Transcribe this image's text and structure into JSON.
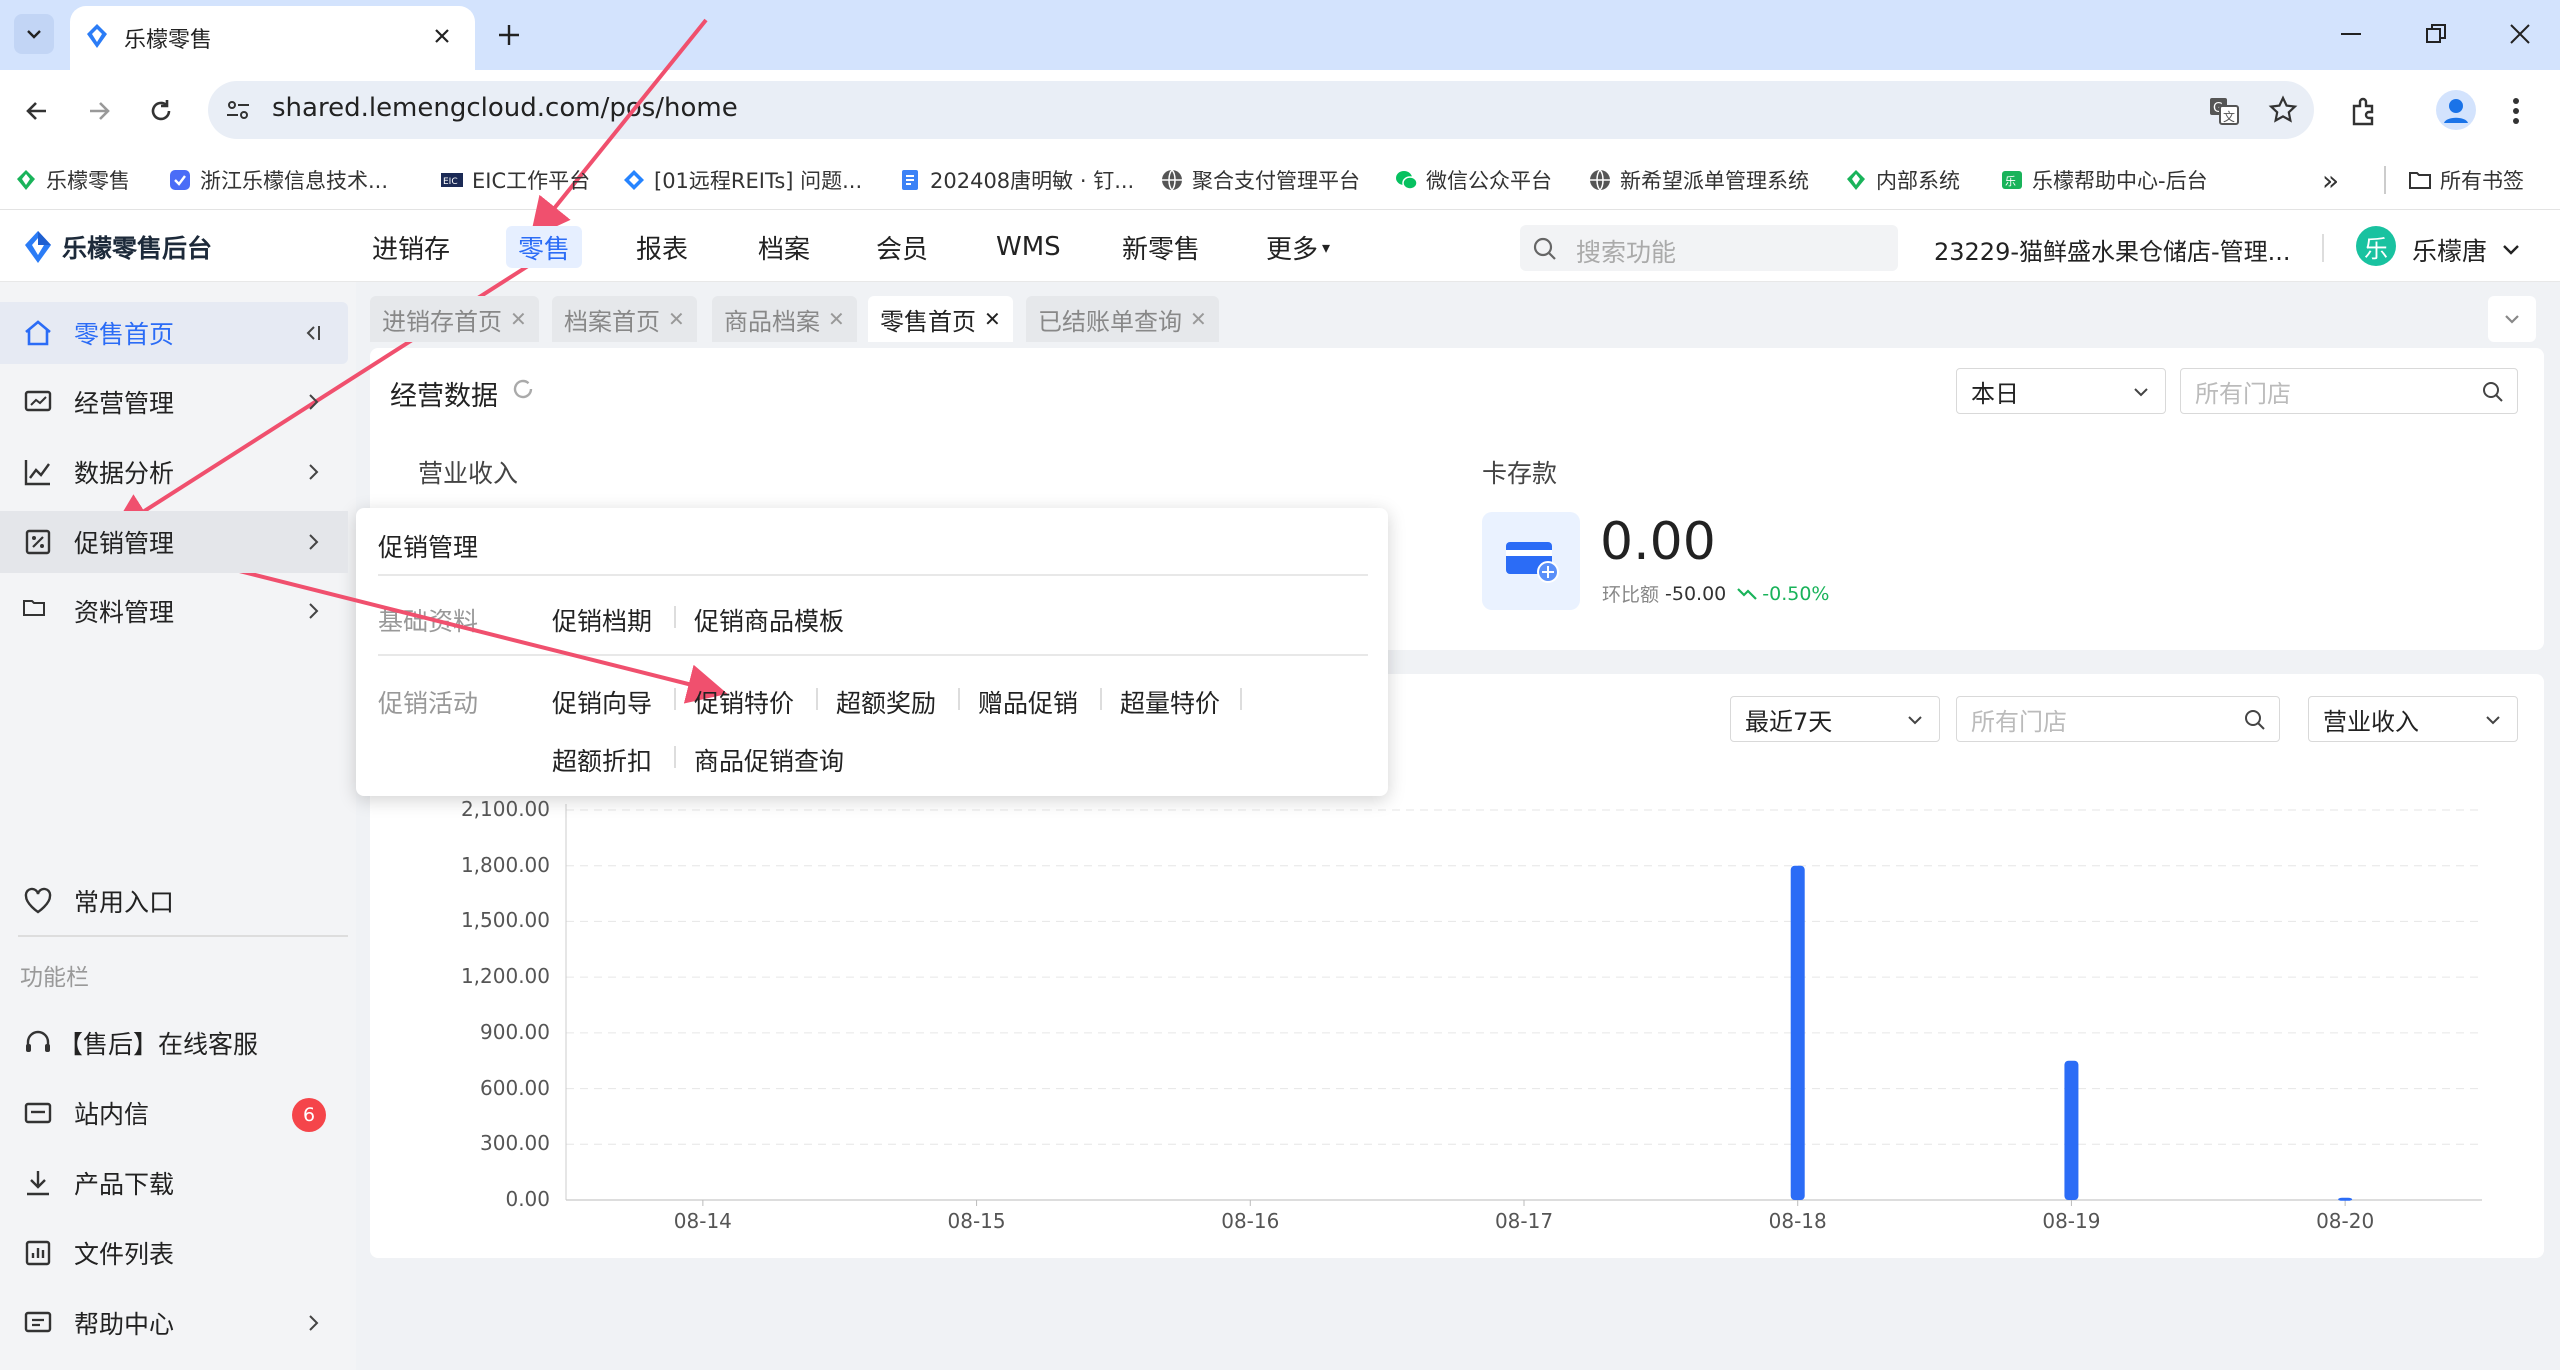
{
  "browser": {
    "tab_title": "乐檬零售",
    "url": "shared.lemengcloud.com/pos/home",
    "bookmarks": [
      {
        "label": "乐檬零售",
        "icon": "lemon-leaf-icon"
      },
      {
        "label": "浙江乐檬信息技术...",
        "icon": "app-icon"
      },
      {
        "label": "EIC工作平台",
        "icon": "eic-icon"
      },
      {
        "label": "[01远程REITs] 问题...",
        "icon": "jira-icon"
      },
      {
        "label": "202408唐明敏 · 钉...",
        "icon": "doc-icon"
      },
      {
        "label": "聚合支付管理平台",
        "icon": "globe-icon"
      },
      {
        "label": "微信公众平台",
        "icon": "wechat-icon"
      },
      {
        "label": "新希望派单管理系统",
        "icon": "globe-icon"
      },
      {
        "label": "内部系统",
        "icon": "lemon-leaf-icon"
      },
      {
        "label": "乐檬帮助中心-后台",
        "icon": "help-logo-icon"
      }
    ],
    "bookmarks_more": "»",
    "all_bookmarks": "所有书签"
  },
  "app": {
    "logo_text": "乐檬零售后台",
    "nav": [
      "进销存",
      "零售",
      "报表",
      "档案",
      "会员",
      "WMS",
      "新零售",
      "更多"
    ],
    "search_placeholder": "搜索功能",
    "store_name": "23229-猫鲜盛水果仓储店-管理...",
    "user_avatar": "乐",
    "user_name": "乐檬唐"
  },
  "sidebar": {
    "items": [
      {
        "label": "零售首页",
        "icon": "home-icon"
      },
      {
        "label": "经营管理",
        "icon": "monitor-icon"
      },
      {
        "label": "数据分析",
        "icon": "line-chart-icon"
      },
      {
        "label": "促销管理",
        "icon": "promotion-icon"
      },
      {
        "label": "资料管理",
        "icon": "folder-icon"
      }
    ],
    "common_entry": "常用入口",
    "section_label": "功能栏",
    "func_items": [
      {
        "label": "【售后】在线客服",
        "icon": "headset-icon"
      },
      {
        "label": "站内信",
        "icon": "mail-icon",
        "badge": "6"
      },
      {
        "label": "产品下载",
        "icon": "download-icon"
      },
      {
        "label": "文件列表",
        "icon": "file-list-icon"
      },
      {
        "label": "帮助中心",
        "icon": "help-icon"
      }
    ]
  },
  "page_tabs": [
    "进销存首页",
    "档案首页",
    "商品档案",
    "零售首页",
    "已结账单查询"
  ],
  "business": {
    "title": "经营数据",
    "period_select": "本日",
    "store_placeholder": "所有门店",
    "revenue_label": "营业收入",
    "card_deposit_label": "卡存款",
    "card_deposit_value": "0.00",
    "mom_label": "环比额",
    "mom_value": "-50.00",
    "mom_pct": "-0.50%"
  },
  "flyout": {
    "title": "促销管理",
    "row1_label": "基础资料",
    "row1_links": [
      "促销档期",
      "促销商品模板"
    ],
    "row2_label": "促销活动",
    "row2_links": [
      "促销向导",
      "促销特价",
      "超额奖励",
      "赠品促销",
      "超量特价",
      "超额折扣",
      "商品促销查询"
    ]
  },
  "trend": {
    "period_select": "最近7天",
    "store_placeholder": "所有门店",
    "metric_select": "营业收入"
  },
  "chart_data": {
    "type": "bar",
    "categories": [
      "08-14",
      "08-15",
      "08-16",
      "08-17",
      "08-18",
      "08-19",
      "08-20"
    ],
    "values": [
      0,
      0,
      0,
      0,
      1800,
      750,
      12
    ],
    "y_ticks": [
      "0.00",
      "300.00",
      "600.00",
      "900.00",
      "1,200.00",
      "1,500.00",
      "1,800.00",
      "2,100.00"
    ],
    "ylim": [
      0,
      2100
    ],
    "grid": true,
    "bar_color": "#2b6cf6"
  },
  "colors": {
    "accent": "#2b6cf6",
    "annotation_arrow": "#f0506e",
    "badge": "#f5454a",
    "positive_trend": "#19b35a"
  }
}
